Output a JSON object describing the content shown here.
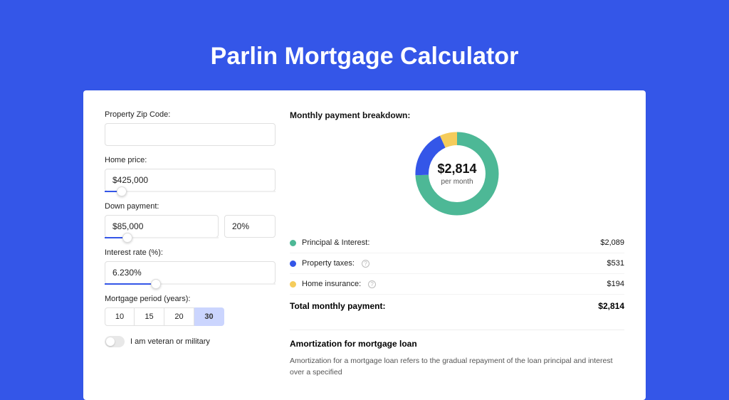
{
  "title": "Parlin Mortgage Calculator",
  "form": {
    "zip_label": "Property Zip Code:",
    "zip_value": "",
    "home_price_label": "Home price:",
    "home_price_value": "$425,000",
    "home_price_slider_pct": 10,
    "down_payment_label": "Down payment:",
    "down_payment_value": "$85,000",
    "down_payment_pct_value": "20%",
    "down_payment_slider_pct": 20,
    "interest_label": "Interest rate (%):",
    "interest_value": "6.230%",
    "interest_slider_pct": 30,
    "period_label": "Mortgage period (years):",
    "periods": [
      "10",
      "15",
      "20",
      "30"
    ],
    "period_active_index": 3,
    "veteran_label": "I am veteran or military",
    "veteran_on": false
  },
  "breakdown": {
    "title": "Monthly payment breakdown:",
    "center_value": "$2,814",
    "center_sub": "per month",
    "items": [
      {
        "label": "Principal & Interest:",
        "value": "$2,089",
        "color": "#4DB896",
        "has_info": false
      },
      {
        "label": "Property taxes:",
        "value": "$531",
        "color": "#3456E8",
        "has_info": true
      },
      {
        "label": "Home insurance:",
        "value": "$194",
        "color": "#F5CC5B",
        "has_info": true
      }
    ],
    "total_label": "Total monthly payment:",
    "total_value": "$2,814"
  },
  "chart_data": {
    "type": "pie",
    "title": "Monthly payment breakdown",
    "series": [
      {
        "name": "Principal & Interest",
        "value": 2089,
        "color": "#4DB896"
      },
      {
        "name": "Property taxes",
        "value": 531,
        "color": "#3456E8"
      },
      {
        "name": "Home insurance",
        "value": 194,
        "color": "#F5CC5B"
      }
    ],
    "total": 2814,
    "center_label": "$2,814 per month"
  },
  "amortization": {
    "title": "Amortization for mortgage loan",
    "body": "Amortization for a mortgage loan refers to the gradual repayment of the loan principal and interest over a specified"
  }
}
